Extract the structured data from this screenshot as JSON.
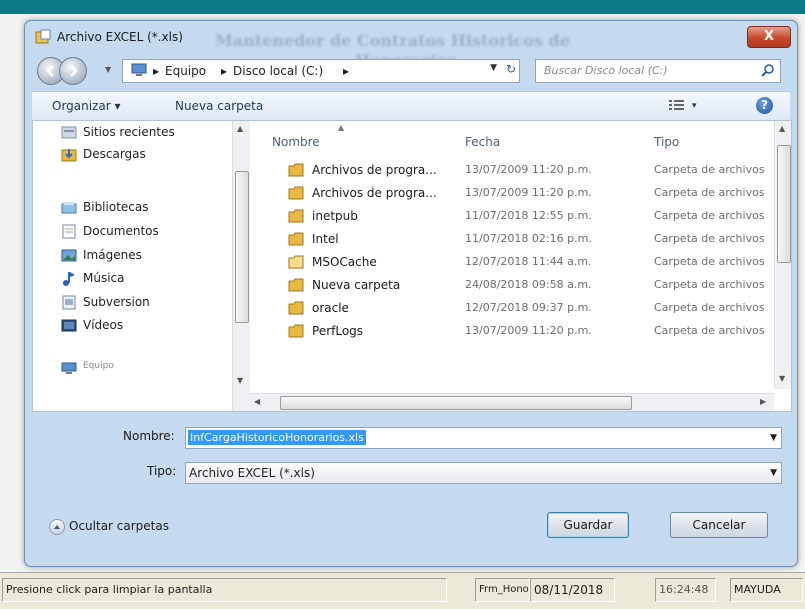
{
  "dialog": {
    "title": "Archivo EXCEL (*.xls)",
    "background_title_line1": "Mantenedor de Contratos Historicos de",
    "background_title_line2": "Honorarios",
    "close_label": "X"
  },
  "address_bar": {
    "crumbs": [
      "Equipo",
      "Disco local (C:)"
    ],
    "separator": "▸"
  },
  "search": {
    "placeholder": "Buscar Disco local (C:)"
  },
  "toolbar": {
    "organize": "Organizar ▾",
    "new_folder": "Nueva carpeta",
    "view_arrow": "▾",
    "help": "?"
  },
  "nav_pane": {
    "items": [
      {
        "label": "Sitios recientes",
        "icon": "recent-places-icon"
      },
      {
        "label": "Descargas",
        "icon": "downloads-icon"
      },
      {
        "label": "Bibliotecas",
        "icon": "libraries-icon"
      },
      {
        "label": "Documentos",
        "icon": "documents-icon"
      },
      {
        "label": "Imágenes",
        "icon": "pictures-icon"
      },
      {
        "label": "Música",
        "icon": "music-icon"
      },
      {
        "label": "Subversion",
        "icon": "subversion-icon"
      },
      {
        "label": "Vídeos",
        "icon": "videos-icon"
      },
      {
        "label": "Equipo",
        "icon": "computer-icon"
      }
    ]
  },
  "files": {
    "columns": {
      "name": "Nombre",
      "date": "Fecha",
      "type": "Tipo"
    },
    "rows": [
      {
        "name": "Archivos de progra...",
        "date": "13/07/2009 11:20 p.m.",
        "type": "Carpeta de archivos"
      },
      {
        "name": "Archivos de progra...",
        "date": "13/07/2009 11:20 p.m.",
        "type": "Carpeta de archivos"
      },
      {
        "name": "inetpub",
        "date": "11/07/2018 12:55 p.m.",
        "type": "Carpeta de archivos"
      },
      {
        "name": "Intel",
        "date": "11/07/2018 02:16 p.m.",
        "type": "Carpeta de archivos"
      },
      {
        "name": "MSOCache",
        "date": "12/07/2018 11:44 a.m.",
        "type": "Carpeta de archivos"
      },
      {
        "name": "Nueva carpeta",
        "date": "24/08/2018 09:58 a.m.",
        "type": "Carpeta de archivos"
      },
      {
        "name": "oracle",
        "date": "12/07/2018 09:37 p.m.",
        "type": "Carpeta de archivos"
      },
      {
        "name": "PerfLogs",
        "date": "13/07/2009 11:20 p.m.",
        "type": "Carpeta de archivos"
      }
    ]
  },
  "form": {
    "name_label": "Nombre:",
    "name_value": "InfCargaHistoricoHonorarios.xls",
    "type_label": "Tipo:",
    "type_value": "Archivo EXCEL (*.xls)",
    "hide_folders": "Ocultar carpetas",
    "save": "Guardar",
    "cancel": "Cancelar"
  },
  "statusbar": {
    "message": "Presione click para limpiar la pantalla",
    "form_name": "Frm_Honorar",
    "date": "08/11/2018",
    "time": "16:24:48",
    "caps": "MAYUDA"
  },
  "colors": {
    "title_strip": "#0b7c86",
    "dialog_frame": "#c5d9ef",
    "close_button": "#c54b2f",
    "selection": "#3399ff",
    "folder": "#e8b840"
  }
}
